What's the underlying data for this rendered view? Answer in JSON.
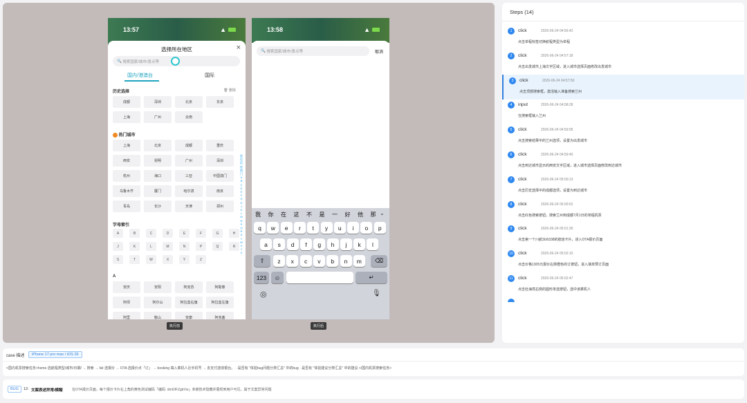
{
  "phone1": {
    "time": "13:57",
    "sheet_title": "选择所在地区",
    "search_placeholder": "搜索国家/城市/景点等",
    "tab_domestic": "国内/港澳台",
    "tab_intl": "国际",
    "history_title": "历史选择",
    "clear_label": "删除",
    "history": [
      "成都",
      "深圳",
      "北京",
      "东京",
      "上海",
      "广州",
      "云南"
    ],
    "hot_title": "热门城市",
    "hot": [
      "上海",
      "北京",
      "成都",
      "重庆",
      "西安",
      "昆明",
      "广州",
      "深圳",
      "杭州",
      "海口",
      "三亚",
      "中国澳门",
      "乌鲁木齐",
      "厦门",
      "哈尔滨",
      "南京",
      "青岛",
      "长沙",
      "天津",
      "郑州"
    ],
    "letter_title": "字母索引",
    "letters": [
      "A",
      "B",
      "C",
      "D",
      "E",
      "F",
      "G",
      "H",
      "J",
      "K",
      "L",
      "M",
      "N",
      "P",
      "Q",
      "R",
      "S",
      "T",
      "W",
      "X",
      "Y",
      "Z"
    ],
    "a_title": "A",
    "a_cities": [
      "安庆",
      "安阳",
      "阿克苏",
      "阿勒泰",
      "阿坝",
      "阿尔山",
      "阿拉善右旗",
      "阿拉善左旗",
      "阿里",
      "鞍山",
      "安康",
      "阿克塞"
    ],
    "index": [
      "定位",
      "历史",
      "热门",
      "A",
      "B",
      "C",
      "D",
      "E",
      "F",
      "G",
      "H",
      "J",
      "K",
      "L",
      "M",
      "N",
      "P",
      "Q",
      "R",
      "S",
      "T",
      "W",
      "X",
      "Y",
      "Z"
    ],
    "caption": "执行前"
  },
  "phone2": {
    "time": "13:58",
    "search_placeholder": "搜索国家/城市/景点等",
    "cancel": "取消",
    "candidates": [
      "我",
      "你",
      "在",
      "这",
      "不",
      "是",
      "一",
      "好",
      "他",
      "那"
    ],
    "row1": [
      "q",
      "w",
      "e",
      "r",
      "t",
      "y",
      "u",
      "i",
      "o",
      "p"
    ],
    "row2": [
      "a",
      "s",
      "d",
      "f",
      "g",
      "h",
      "j",
      "k",
      "l"
    ],
    "row3": [
      "z",
      "x",
      "c",
      "v",
      "b",
      "n",
      "m"
    ],
    "num_key": "123",
    "caption": "执行后"
  },
  "steps": {
    "title": "Steps (14)",
    "items": [
      {
        "n": "1",
        "action": "click",
        "time": "2026-06-24 04:56:42",
        "desc": "点击单程标签切换航程类型为单程"
      },
      {
        "n": "2",
        "action": "click",
        "time": "2026-06-24 04:57:18",
        "desc": "点击出发城市上海文字区域，进入城市选择页面修改出发城市"
      },
      {
        "n": "3",
        "action": "click",
        "time": "2026-06-24 04:57:50",
        "desc": "点击顶部搜索框，激活输入准备搜索兰州"
      },
      {
        "n": "4",
        "action": "input",
        "time": "2026-06-24 04:58:28",
        "desc": "在搜索框输入兰州"
      },
      {
        "n": "5",
        "action": "click",
        "time": "2026-06-24 04:59:05",
        "desc": "点击搜索结果中的兰州选项，设置为出发城市"
      },
      {
        "n": "6",
        "action": "click",
        "time": "2026-06-24 04:59:40",
        "desc": "点击到达城市显示的西安文字区域，进入城市选择页面修改到达城市"
      },
      {
        "n": "7",
        "action": "click",
        "time": "2026-06-24 05:00:13",
        "desc": "点击历史选择中的成都选项，设置为到达城市"
      },
      {
        "n": "8",
        "action": "click",
        "time": "2026-06-24 05:00:52",
        "desc": "点击红色搜索按钮，搜索兰州到成都7月1日的单程机票"
      },
      {
        "n": "9",
        "action": "click",
        "time": "2026-06-24 05:01:30",
        "desc": "点击第一个川航3U6338的航班卡片，进入OTA报价页面"
      },
      {
        "n": "10",
        "action": "click",
        "time": "2026-06-24 05:02:10",
        "desc": "点击价格1305元报价右侧橙色的订按钮，进入填单预订页面"
      },
      {
        "n": "11",
        "action": "click",
        "time": "2026-06-24 05:02:47",
        "desc": "点击杜海亮右侧的圆形单选按钮，选中该乘机人"
      }
    ]
  },
  "case": {
    "label": "case 描述",
    "device": "iPhone 17 pro max / iOS 26",
    "text": "<国内机票搜索任务>home 选航程类型/城市/日期/ → 搜索 → list 选报价 → OTA 选报价点「订」 → booking 填入乘机人近手机号 → 去支付送收银台。 · 是否有 \"体验bug问题分类汇总\" 中的bug · 是否有 \"体验建议分类汇总\" 中的建议 </国内机票搜索任务>"
  },
  "bug": {
    "tag": "BUG",
    "count": "12",
    "title": "文案表述异常/模糊",
    "desc": "在OTA报价页面，每个报价卡片右上角的黄色测试编码「编码: dmGfFZgbVw」未被技术隐藏并展现到用户可见，属于文案异常问题"
  }
}
